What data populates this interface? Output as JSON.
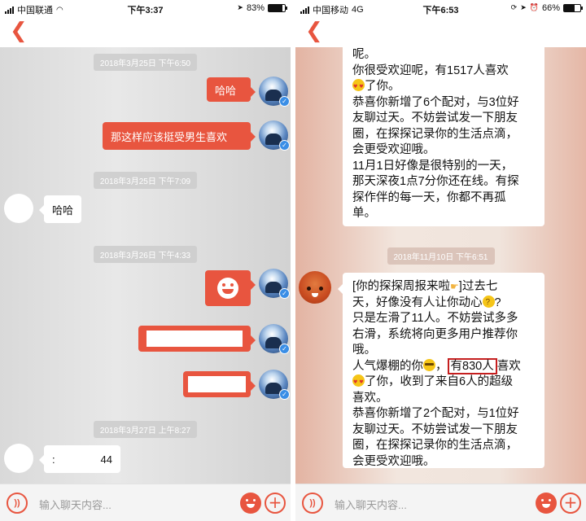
{
  "left": {
    "status": {
      "carrier": "中国联通",
      "time": "下午3:37",
      "battery": "83%",
      "battery_level": 0.83
    },
    "timestamps": [
      "2018年3月25日 下午6:50",
      "2018年3月25日 下午7:09",
      "2018年3月26日 下午4:33",
      "2018年3月27日 上午8:27"
    ],
    "messages": {
      "m1": "哈哈",
      "m2": "那这样应该挺受男生喜欢",
      "m3": "哈哈",
      "m4_prefix": ":",
      "m4_suffix": "44"
    },
    "input_placeholder": "输入聊天内容..."
  },
  "right": {
    "status": {
      "carrier": "中国移动",
      "network": "4G",
      "time": "下午6:53",
      "battery": "66%",
      "battery_level": 0.66
    },
    "timestamp": "2018年11月10日 下午6:51",
    "card_top": {
      "l1": "呢。",
      "l2": "你很受欢迎呢，有1517人喜欢",
      "l3": "了你。",
      "l4": "恭喜你新增了6个配对，与3位好",
      "l5": "友聊过天。不妨尝试发一下朋友",
      "l6": "圈，在探探记录你的生活点滴，",
      "l7": "会更受欢迎哦。",
      "l8": "11月1日好像是很特别的一天，",
      "l9": "那天深夜1点7分你还在线。有探",
      "l10": "探作伴的每一天，你都不再孤",
      "l11": "单。"
    },
    "card_main": {
      "l1a": "[你的探探周报来啦",
      "l1b": "]过去七",
      "l2a": "天，好像没有人让你动心",
      "l2b": "?",
      "l3": "只是左滑了11人。不妨尝试多多",
      "l4": "右滑，系统将向更多用户推荐你",
      "l5": "哦。",
      "l6a": "人气爆棚的你",
      "l6b": "，",
      "l6_highlight": "有830人",
      "l6c": "喜欢",
      "l7": "了你，收到了来自6人的超级",
      "l8": "喜欢。",
      "l9": "恭喜你新增了2个配对，与1位好",
      "l10": "友聊过天。不妨尝试发一下朋友",
      "l11": "圈，在探探记录你的生活点滴，",
      "l12": "会更受欢迎哦。"
    },
    "input_placeholder": "输入聊天内容..."
  },
  "icons": {
    "back": "chevron-left-icon",
    "voice": "voice-icon",
    "emoji": "emoji-icon",
    "plus": "plus-icon",
    "verified": "verified-badge-icon"
  },
  "colors": {
    "accent": "#e8553f",
    "highlight_box": "#c51f1f",
    "verified": "#3a8ee6"
  }
}
